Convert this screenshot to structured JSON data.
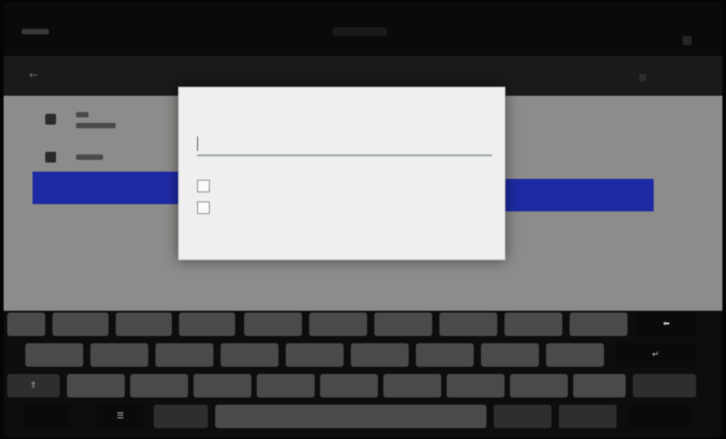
{
  "status_bar": {
    "time": "",
    "notification": ""
  },
  "action_bar": {
    "back_icon": "back-arrow-icon",
    "menu_icon": "overflow-menu-icon"
  },
  "app_list": {
    "rows": [
      {
        "icon": "folder-icon",
        "primary": "",
        "secondary": ""
      },
      {
        "icon": "file-icon",
        "primary": ""
      }
    ],
    "selected_highlight_color": "#1e2aa3"
  },
  "dialog": {
    "title": "",
    "field_label": "",
    "input_value": "",
    "checkboxes": [
      {
        "label": "",
        "checked": false
      },
      {
        "label": "",
        "checked": false
      }
    ],
    "buttons": {
      "cancel": "",
      "ok": ""
    }
  },
  "keyboard": {
    "row1": [
      "",
      "",
      "",
      "",
      "",
      "",
      "",
      "",
      "",
      "",
      ""
    ],
    "row2": [
      "",
      "",
      "",
      "",
      "",
      "",
      "",
      "",
      "",
      ""
    ],
    "row3": [
      "",
      "",
      "",
      "",
      "",
      "",
      "",
      "",
      "",
      ""
    ],
    "row4": [
      "",
      "",
      "",
      "",
      "",
      ""
    ],
    "backspace_icon": "backspace-icon",
    "enter_icon": "enter-icon",
    "shift_icon": "shift-icon"
  }
}
